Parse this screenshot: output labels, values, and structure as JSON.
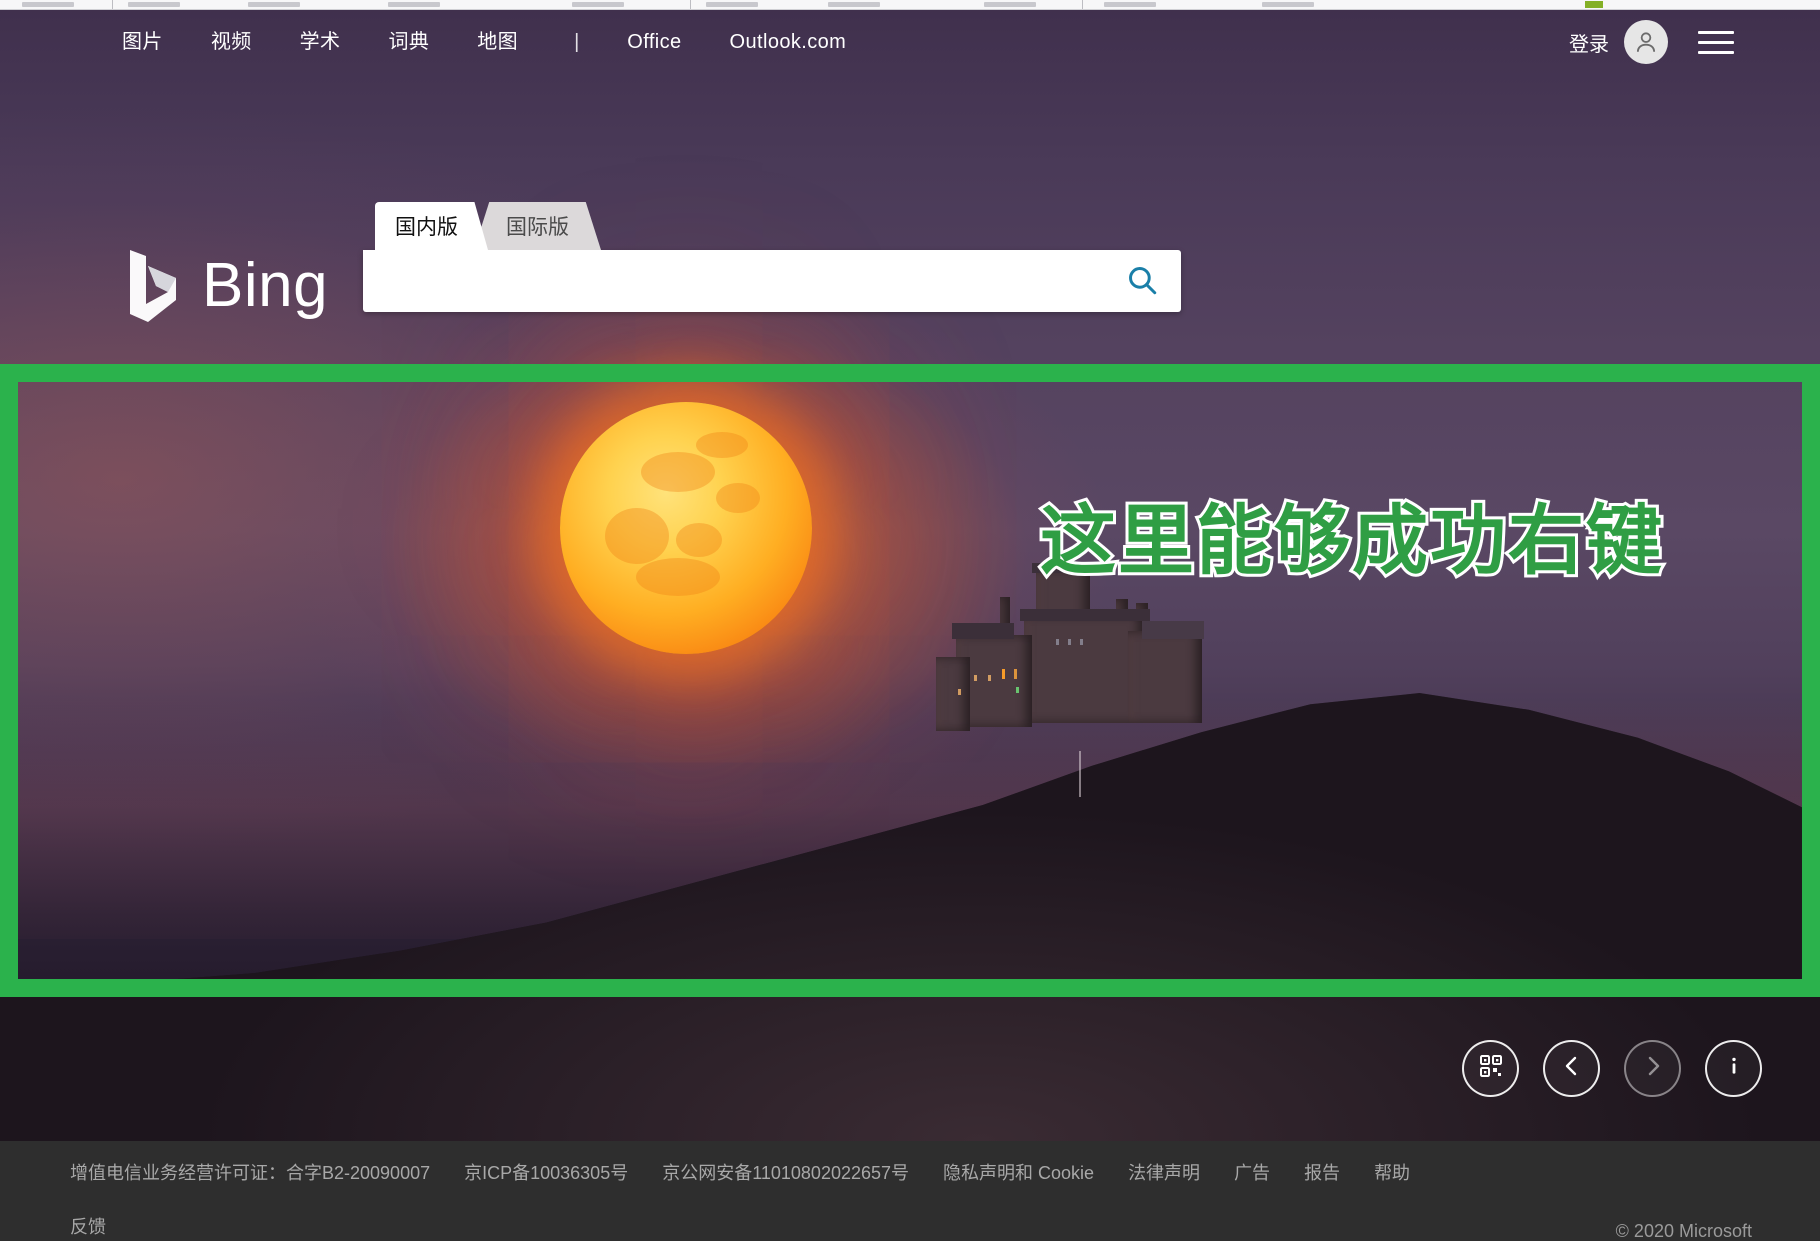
{
  "browser": {
    "tab_count": 9
  },
  "topnav": {
    "items": [
      {
        "label": "图片",
        "name": "nav-images"
      },
      {
        "label": "视频",
        "name": "nav-videos"
      },
      {
        "label": "学术",
        "name": "nav-academic"
      },
      {
        "label": "词典",
        "name": "nav-dictionary"
      },
      {
        "label": "地图",
        "name": "nav-maps"
      }
    ],
    "separator": "|",
    "items_right": [
      {
        "label": "Office",
        "name": "nav-office"
      },
      {
        "label": "Outlook.com",
        "name": "nav-outlook"
      }
    ],
    "signin_label": "登录",
    "avatar_icon": "person-icon",
    "menu_icon": "hamburger-menu-icon"
  },
  "logo": {
    "wordmark": "Bing",
    "mark_icon": "bing-b-icon"
  },
  "search": {
    "tabs": [
      {
        "label": "国内版",
        "active": true
      },
      {
        "label": "国际版",
        "active": false
      }
    ],
    "value": "",
    "placeholder": "",
    "button_icon": "search-icon",
    "accent_color": "#1a7fa8"
  },
  "annotation": {
    "text": "这里能够成功右键",
    "box_color": "#2bb24c",
    "text_color": "#2f9e44",
    "outline_color": "#ffffff"
  },
  "hero": {
    "description": "moonrise-over-castle-photo",
    "moon_color": "#ffd24f",
    "sky_color": "#54425f"
  },
  "controls": [
    {
      "name": "qr-code-button",
      "icon": "qr-code-icon",
      "dim": false
    },
    {
      "name": "previous-image-button",
      "icon": "chevron-left-icon",
      "dim": false
    },
    {
      "name": "next-image-button",
      "icon": "chevron-right-icon",
      "dim": true
    },
    {
      "name": "image-info-button",
      "icon": "info-icon",
      "dim": false
    }
  ],
  "footer": {
    "links_row1": [
      {
        "label": "增值电信业务经营许可证：合字B2-20090007",
        "name": "footer-telecom-license"
      },
      {
        "label": "京ICP备10036305号",
        "name": "footer-icp"
      },
      {
        "label": "京公网安备11010802022657号",
        "name": "footer-public-security"
      },
      {
        "label": "隐私声明和 Cookie",
        "name": "footer-privacy"
      },
      {
        "label": "法律声明",
        "name": "footer-legal"
      },
      {
        "label": "广告",
        "name": "footer-ads"
      },
      {
        "label": "报告",
        "name": "footer-report"
      },
      {
        "label": "帮助",
        "name": "footer-help"
      }
    ],
    "feedback_label": "反馈",
    "copyright": "© 2020 Microsoft"
  }
}
